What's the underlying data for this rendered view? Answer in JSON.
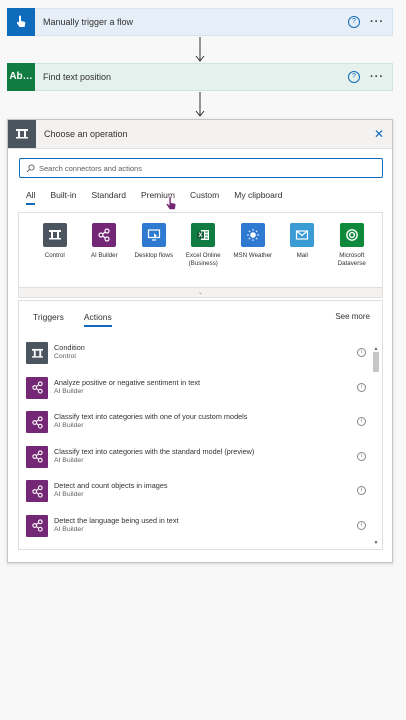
{
  "steps": [
    {
      "title": "Manually trigger a flow",
      "badge": "",
      "help": "?",
      "more": "···",
      "color": "#0f6cbd"
    },
    {
      "title": "Find text position",
      "badge": "Ab…",
      "help": "?",
      "more": "···",
      "color": "#107c41"
    }
  ],
  "panel": {
    "title": "Choose an operation",
    "close": "✕",
    "search_placeholder": "Search connectors and actions",
    "tabs": [
      "All",
      "Built-in",
      "Standard",
      "Premium",
      "Custom",
      "My clipboard"
    ],
    "active_tab": "All",
    "connectors": [
      {
        "label": "Control",
        "icon": "control-icon",
        "color": "#4a5560"
      },
      {
        "label": "AI Builder",
        "icon": "ai-builder-icon",
        "color": "#742774"
      },
      {
        "label": "Desktop flows",
        "icon": "desktop-flows-icon",
        "color": "#2e7ad1"
      },
      {
        "label": "Excel Online (Business)",
        "icon": "excel-icon",
        "color": "#107c41"
      },
      {
        "label": "MSN Weather",
        "icon": "weather-icon",
        "color": "#2e7ad1"
      },
      {
        "label": "Mail",
        "icon": "mail-icon",
        "color": "#3a9bd5"
      },
      {
        "label": "Microsoft Dataverse",
        "icon": "dataverse-icon",
        "color": "#0f8a3c"
      }
    ],
    "expand": "⌄",
    "subtabs": [
      "Triggers",
      "Actions"
    ],
    "active_subtab": "Actions",
    "see_more": "See more",
    "actions": [
      {
        "name": "Condition",
        "connector": "Control",
        "icon": "control-icon",
        "color": "#4a5560"
      },
      {
        "name": "Analyze positive or negative sentiment in text",
        "connector": "AI Builder",
        "icon": "ai-builder-icon",
        "color": "#742774"
      },
      {
        "name": "Classify text into categories with one of your custom models",
        "connector": "AI Builder",
        "icon": "ai-builder-icon",
        "color": "#742774"
      },
      {
        "name": "Classify text into categories with the standard model (preview)",
        "connector": "AI Builder",
        "icon": "ai-builder-icon",
        "color": "#742774"
      },
      {
        "name": "Detect and count objects in images",
        "connector": "AI Builder",
        "icon": "ai-builder-icon",
        "color": "#742774"
      },
      {
        "name": "Detect the language being used in text",
        "connector": "AI Builder",
        "icon": "ai-builder-icon",
        "color": "#742774"
      }
    ],
    "info": "i"
  }
}
